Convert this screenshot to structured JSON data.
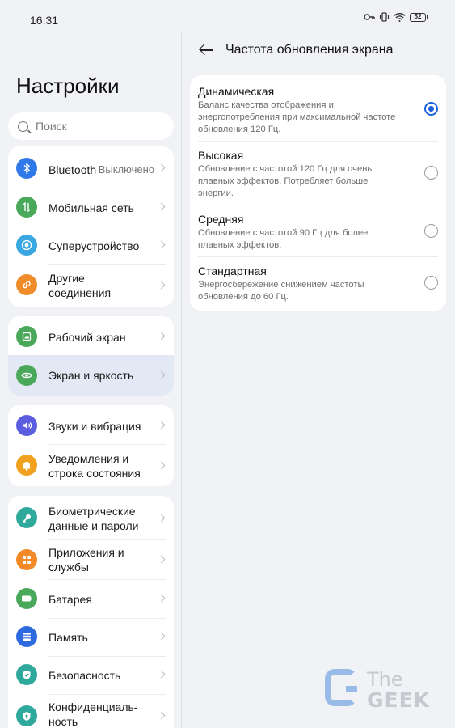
{
  "status_bar": {
    "time": "16:31",
    "battery": "52"
  },
  "left": {
    "title": "Настройки",
    "search": {
      "placeholder": "Поиск"
    },
    "groups": [
      {
        "items": [
          {
            "label": "Bluetooth",
            "value": "Выключено",
            "icon": "bluetooth-icon",
            "color": "#2f79e8"
          },
          {
            "label": "Мобильная сеть",
            "icon": "mobile-network-icon",
            "color": "#49a85a"
          },
          {
            "label": "Суперустройство",
            "icon": "super-device-icon",
            "color": "#3aa7e0"
          },
          {
            "label": "Другие соединения",
            "icon": "link-icon",
            "color": "#ef8d2a"
          }
        ]
      },
      {
        "items": [
          {
            "label": "Рабочий экран",
            "icon": "home-screen-icon",
            "color": "#49a85a"
          },
          {
            "label": "Экран и яркость",
            "icon": "eye-icon",
            "color": "#49a85a",
            "active": true
          }
        ]
      },
      {
        "items": [
          {
            "label": "Звуки и вибрация",
            "icon": "sound-icon",
            "color": "#5b5ce0"
          },
          {
            "label": "Уведомления и строка состояния",
            "icon": "bell-icon",
            "color": "#f0a21e"
          }
        ]
      },
      {
        "items": [
          {
            "label": "Биометрические данные и пароли",
            "icon": "key-icon",
            "color": "#2fa99c"
          },
          {
            "label": "Приложения и службы",
            "icon": "apps-icon",
            "color": "#f28a27"
          },
          {
            "label": "Батарея",
            "icon": "battery-icon",
            "color": "#49a85a"
          },
          {
            "label": "Память",
            "icon": "storage-icon",
            "color": "#2d6ae0"
          },
          {
            "label": "Безопасность",
            "icon": "shield-icon",
            "color": "#2fa99c"
          },
          {
            "label": "Конфиденциаль-ность",
            "icon": "privacy-icon",
            "color": "#2fa99c"
          }
        ]
      }
    ]
  },
  "right": {
    "title": "Частота обновления экрана",
    "options": [
      {
        "title": "Динамическая",
        "desc": "Баланс качества отображения и энергопотребления при максимальной частоте обновления 120 Гц.",
        "selected": true
      },
      {
        "title": "Высокая",
        "desc": "Обновление с частотой 120 Гц для очень плавных эффектов. Потребляет больше энергии.",
        "selected": false
      },
      {
        "title": "Средняя",
        "desc": "Обновление с частотой 90 Гц для более плавных эффектов.",
        "selected": false
      },
      {
        "title": "Стандартная",
        "desc": "Энергосбережение снижением частоты обновления до 60 Гц.",
        "selected": false
      }
    ]
  },
  "watermark": {
    "line1": "The",
    "line2": "GEEK"
  }
}
